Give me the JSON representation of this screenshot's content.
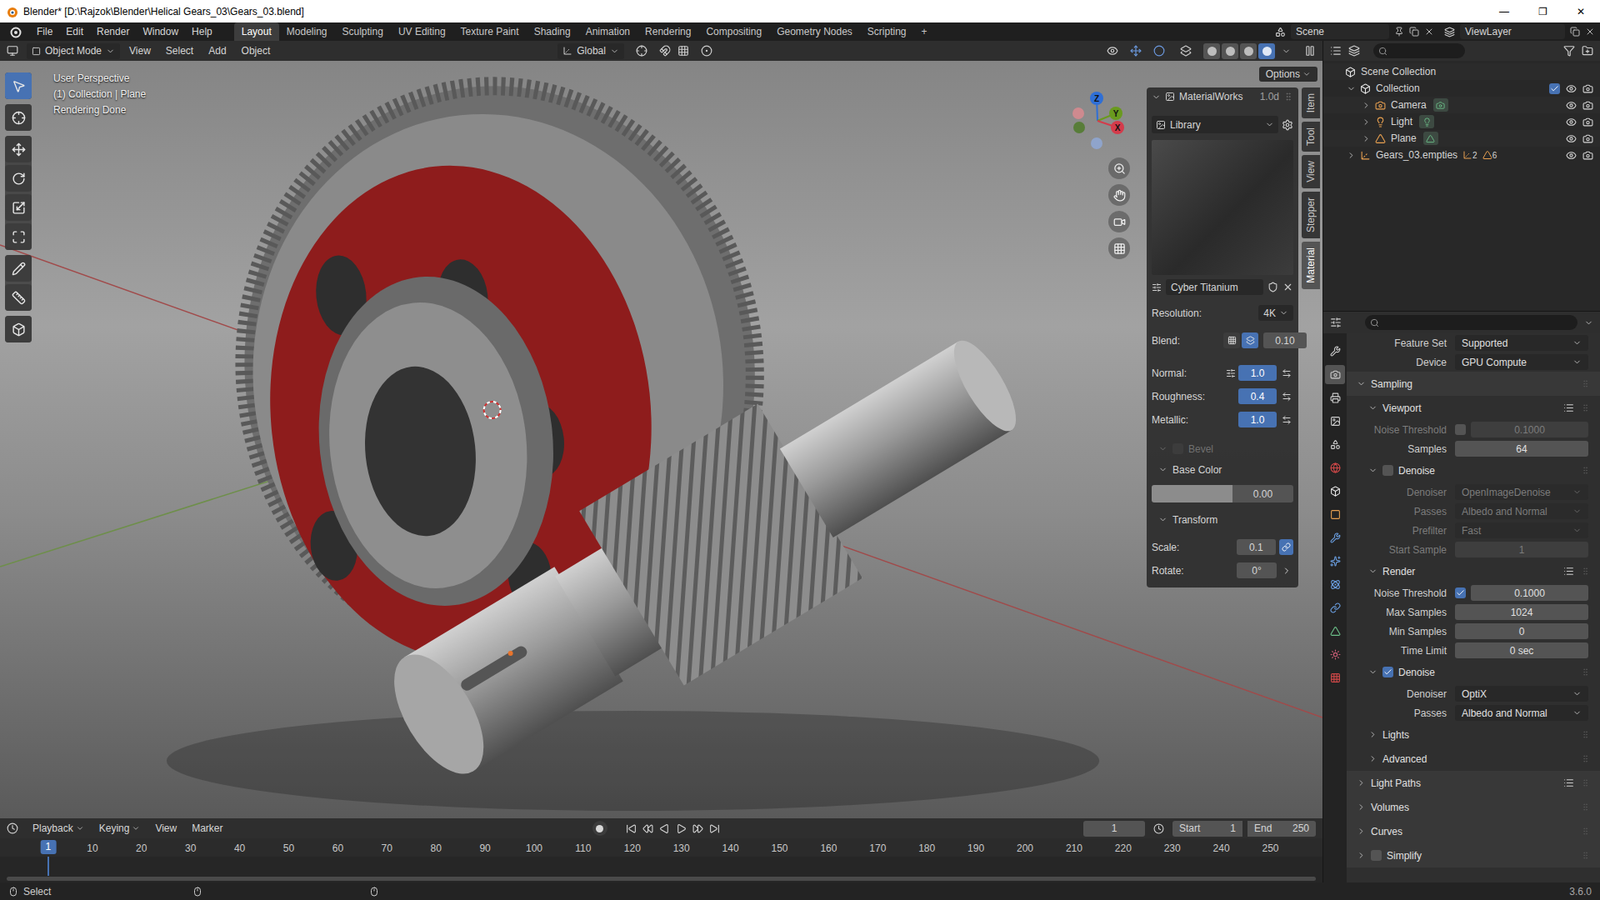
{
  "window": {
    "title": "Blender* [D:\\Rajzok\\Blender\\Helical Gears_03\\Gears_03.blend]",
    "controls": [
      "—",
      "❐",
      "✕"
    ]
  },
  "menu": [
    "File",
    "Edit",
    "Render",
    "Window",
    "Help"
  ],
  "workspaces": [
    {
      "label": "Layout",
      "selected": true
    },
    {
      "label": "Modeling",
      "selected": false
    },
    {
      "label": "Sculpting",
      "selected": false
    },
    {
      "label": "UV Editing",
      "selected": false
    },
    {
      "label": "Texture Paint",
      "selected": false
    },
    {
      "label": "Shading",
      "selected": false
    },
    {
      "label": "Animation",
      "selected": false
    },
    {
      "label": "Rendering",
      "selected": false
    },
    {
      "label": "Compositing",
      "selected": false
    },
    {
      "label": "Geometry Nodes",
      "selected": false
    },
    {
      "label": "Scripting",
      "selected": false
    },
    {
      "label": "+",
      "selected": false
    }
  ],
  "scene": "Scene",
  "view_layer": "ViewLayer",
  "viewport_header": {
    "mode": "Object Mode",
    "menus": [
      "View",
      "Select",
      "Add",
      "Object"
    ],
    "orientation": "Global",
    "options": "Options",
    "shading": [
      {
        "selected": false
      },
      {
        "selected": false
      },
      {
        "selected": false
      },
      {
        "selected": true
      }
    ]
  },
  "tools": [
    {
      "selected": true
    },
    {
      "selected": false
    },
    {
      "selected": false
    },
    {
      "selected": false
    },
    {
      "selected": false
    },
    {
      "selected": false
    },
    {
      "selected": false
    },
    {
      "selected": false
    },
    {
      "selected": false
    }
  ],
  "viewport": {
    "overlay": [
      "User Perspective",
      "(1) Collection | Plane",
      "Rendering Done"
    ],
    "gizmo": [
      {
        "label": "Z",
        "color": "#2f6fd6"
      },
      {
        "label": "Y",
        "color": "#6a9a1f"
      },
      {
        "label": "X",
        "color": "#d43b4b"
      }
    ]
  },
  "sidebar_tabs": [
    {
      "label": "Item",
      "selected": false
    },
    {
      "label": "Tool",
      "selected": false
    },
    {
      "label": "View",
      "selected": false
    },
    {
      "label": "Stepper",
      "selected": false
    },
    {
      "label": "Material",
      "selected": true
    }
  ],
  "material_panel": {
    "addon": "MaterialWorks",
    "version": "1.0d",
    "library": "Library",
    "material": "Cyber Titanium",
    "resolution": {
      "label": "Resolution:",
      "value": "4K"
    },
    "blend": {
      "label": "Blend:",
      "value": "0.10",
      "modes": [
        {
          "selected": false
        },
        {
          "selected": true
        }
      ]
    },
    "sliders": [
      {
        "label": "Normal:",
        "value": "1.0",
        "options": true
      },
      {
        "label": "Roughness:",
        "value": "0.4",
        "options": false
      },
      {
        "label": "Metallic:",
        "value": "1.0",
        "options": false
      }
    ],
    "bevel": {
      "label": "Bevel",
      "expanded": true,
      "checked": false,
      "disabled": true
    },
    "base_color": {
      "label": "Base Color",
      "expanded": true,
      "value": "0.00",
      "color": "#8c8c8c"
    },
    "transform": {
      "label": "Transform",
      "expanded": true,
      "scale": {
        "label": "Scale:",
        "value": "0.1",
        "linked": true
      },
      "rotate": {
        "label": "Rotate:",
        "value": "0°"
      }
    }
  },
  "outliner": {
    "root": "Scene Collection",
    "items": [
      {
        "name": "Collection",
        "kind": "collection",
        "depth": 0,
        "expandable": true,
        "expanded": true,
        "checkbox": true,
        "checked": true,
        "visible": true,
        "data_icon": false,
        "children": []
      },
      {
        "name": "Camera",
        "kind": "camera",
        "depth": 1,
        "expandable": true,
        "expanded": false,
        "checkbox": false,
        "checked": false,
        "visible": true,
        "data_icon": true,
        "children": []
      },
      {
        "name": "Light",
        "kind": "light",
        "depth": 1,
        "expandable": true,
        "expanded": false,
        "checkbox": false,
        "checked": false,
        "visible": true,
        "data_icon": true,
        "children": []
      },
      {
        "name": "Plane",
        "kind": "mesh",
        "depth": 1,
        "expandable": true,
        "expanded": false,
        "checkbox": false,
        "checked": false,
        "visible": true,
        "data_icon": true,
        "children": []
      },
      {
        "name": "Gears_03.empties",
        "kind": "empty",
        "depth": 0,
        "expandable": true,
        "expanded": false,
        "checkbox": false,
        "checked": false,
        "visible": true,
        "data_icon": false,
        "children": [
          {
            "kind": "empty",
            "count": "2"
          },
          {
            "kind": "mesh",
            "count": "6"
          }
        ]
      }
    ]
  },
  "property_tabs": [
    {
      "selected": false
    },
    {
      "selected": true
    },
    {
      "selected": false
    },
    {
      "selected": false
    },
    {
      "selected": false
    },
    {
      "selected": false
    },
    {
      "selected": false
    },
    {
      "selected": false
    },
    {
      "selected": false
    },
    {
      "selected": false
    },
    {
      "selected": false
    },
    {
      "selected": false
    },
    {
      "selected": false
    },
    {
      "selected": false
    },
    {
      "selected": false
    }
  ],
  "properties": [
    {
      "kind": "field",
      "label": "Feature Set",
      "value": "Supported",
      "dropdown": true,
      "disabled": false,
      "checkbox": false,
      "checked": false
    },
    {
      "kind": "field",
      "label": "Device",
      "value": "GPU Compute",
      "dropdown": true,
      "disabled": false,
      "checkbox": false,
      "checked": false
    },
    {
      "kind": "panel",
      "label": "Sampling",
      "expanded": true,
      "presets": false,
      "checkbox": false,
      "checked": false
    },
    {
      "kind": "subpanel",
      "label": "Viewport",
      "expanded": true,
      "presets": true,
      "checkbox": false,
      "checked": false
    },
    {
      "kind": "field",
      "label": "Noise Threshold",
      "value": "0.1000",
      "dropdown": false,
      "disabled": true,
      "checkbox": true,
      "checked": false
    },
    {
      "kind": "field",
      "label": "Samples",
      "value": "64",
      "dropdown": false,
      "disabled": false,
      "checkbox": false,
      "checked": false
    },
    {
      "kind": "subsubpanel",
      "label": "Denoise",
      "expanded": true,
      "presets": false,
      "checkbox": true,
      "checked": false
    },
    {
      "kind": "field",
      "label": "Denoiser",
      "value": "OpenImageDenoise",
      "dropdown": true,
      "disabled": true,
      "checkbox": false,
      "checked": false
    },
    {
      "kind": "field",
      "label": "Passes",
      "value": "Albedo and Normal",
      "dropdown": true,
      "disabled": true,
      "checkbox": false,
      "checked": false
    },
    {
      "kind": "field",
      "label": "Prefilter",
      "value": "Fast",
      "dropdown": true,
      "disabled": true,
      "checkbox": false,
      "checked": false
    },
    {
      "kind": "field",
      "label": "Start Sample",
      "value": "1",
      "dropdown": false,
      "disabled": true,
      "checkbox": false,
      "checked": false
    },
    {
      "kind": "subpanel",
      "label": "Render",
      "expanded": true,
      "presets": true,
      "checkbox": false,
      "checked": false
    },
    {
      "kind": "field",
      "label": "Noise Threshold",
      "value": "0.1000",
      "dropdown": false,
      "disabled": false,
      "checkbox": true,
      "checked": true
    },
    {
      "kind": "field",
      "label": "Max Samples",
      "value": "1024",
      "dropdown": false,
      "disabled": false,
      "checkbox": false,
      "checked": false
    },
    {
      "kind": "field",
      "label": "Min Samples",
      "value": "0",
      "dropdown": false,
      "disabled": false,
      "checkbox": false,
      "checked": false
    },
    {
      "kind": "field",
      "label": "Time Limit",
      "value": "0 sec",
      "dropdown": false,
      "disabled": false,
      "checkbox": false,
      "checked": false
    },
    {
      "kind": "subsubpanel",
      "label": "Denoise",
      "expanded": true,
      "presets": false,
      "checkbox": true,
      "checked": true
    },
    {
      "kind": "field",
      "label": "Denoiser",
      "value": "OptiX",
      "dropdown": true,
      "disabled": false,
      "checkbox": false,
      "checked": false
    },
    {
      "kind": "field",
      "label": "Passes",
      "value": "Albedo and Normal",
      "dropdown": true,
      "disabled": false,
      "checkbox": false,
      "checked": false
    },
    {
      "kind": "subpanel",
      "label": "Lights",
      "expanded": false,
      "presets": false,
      "checkbox": false,
      "checked": false
    },
    {
      "kind": "subpanel",
      "label": "Advanced",
      "expanded": false,
      "presets": false,
      "checkbox": false,
      "checked": false
    },
    {
      "kind": "panel",
      "label": "Light Paths",
      "expanded": false,
      "presets": true,
      "checkbox": false,
      "checked": false
    },
    {
      "kind": "panel",
      "label": "Volumes",
      "expanded": false,
      "presets": false,
      "checkbox": false,
      "checked": false
    },
    {
      "kind": "panel",
      "label": "Curves",
      "expanded": false,
      "presets": false,
      "checkbox": false,
      "checked": false
    },
    {
      "kind": "panel",
      "label": "Simplify",
      "expanded": false,
      "presets": false,
      "checkbox": true,
      "checked": false
    }
  ],
  "timeline": {
    "menus": [
      "Playback",
      "Keying",
      "View",
      "Marker"
    ],
    "frame": "1",
    "start_label": "Start",
    "start": "1",
    "end_label": "End",
    "end": "250",
    "current": "1",
    "ruler": [
      "10",
      "20",
      "30",
      "40",
      "50",
      "60",
      "70",
      "80",
      "90",
      "100",
      "110",
      "120",
      "130",
      "140",
      "150",
      "160",
      "170",
      "180",
      "190",
      "200",
      "210",
      "220",
      "230",
      "240",
      "250"
    ]
  },
  "status_bar": {
    "left": "Select",
    "version": "3.6.0"
  }
}
